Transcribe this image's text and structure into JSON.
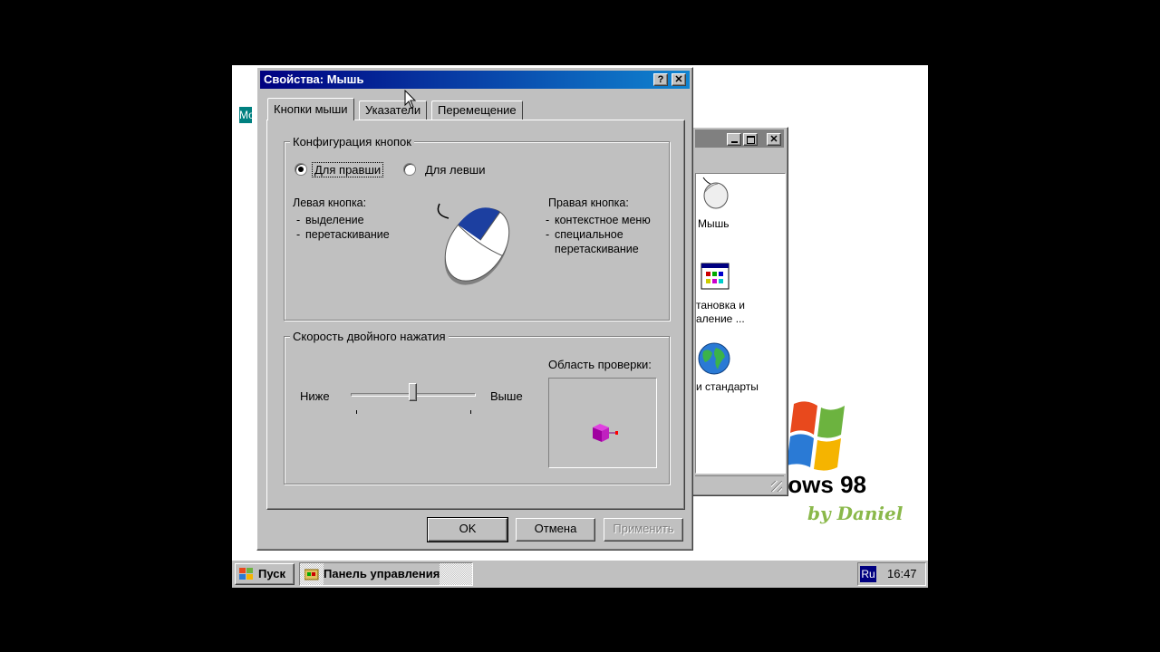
{
  "desktop": {
    "side_label": "Мо",
    "logo_text": "Windows 98",
    "logo_sub": "by Daniel"
  },
  "bg_window": {
    "icons": [
      {
        "label": "Мышь",
        "icon": "mouse-icon"
      },
      {
        "label": "тановка и\nаление ...",
        "icon": "install-programs-icon"
      },
      {
        "label": "и стандарты",
        "icon": "globe-icon"
      }
    ]
  },
  "dialog": {
    "title": "Свойства: Мышь",
    "help_glyph": "?",
    "close_glyph": "✕",
    "tabs": [
      "Кнопки мыши",
      "Указатели",
      "Перемещение"
    ],
    "config_group": {
      "label": "Конфигурация кнопок",
      "right_handed": "Для правши",
      "left_handed": "Для левши",
      "left_button_title": "Левая кнопка:",
      "left_button_items": [
        "выделение",
        "перетаскивание"
      ],
      "right_button_title": "Правая кнопка:",
      "right_button_items": [
        "контекстное меню",
        "специальное\nперетаскивание"
      ]
    },
    "dblclick_group": {
      "label": "Скорость двойного нажатия",
      "slow": "Ниже",
      "fast": "Выше",
      "test_area": "Область проверки:",
      "speed_level": 0.5
    },
    "buttons": {
      "ok": "OK",
      "cancel": "Отмена",
      "apply": "Применить"
    }
  },
  "taskbar": {
    "start": "Пуск",
    "task": "Панель управления",
    "lang": "Ru",
    "clock": "16:47"
  },
  "colors": {
    "title_active": "#000080",
    "face": "#c0c0c0",
    "lang_bg": "#000080"
  }
}
